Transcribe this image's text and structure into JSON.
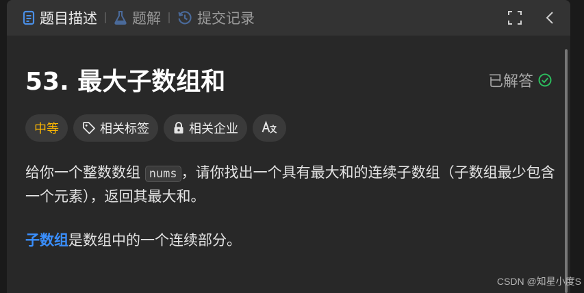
{
  "tabs": [
    {
      "label": "题目描述",
      "icon": "document-icon"
    },
    {
      "label": "题解",
      "icon": "flask-icon"
    },
    {
      "label": "提交记录",
      "icon": "history-icon"
    }
  ],
  "problem": {
    "title": "53. 最大子数组和",
    "status": "已解答"
  },
  "tags": {
    "difficulty": "中等",
    "related_tags": "相关标签",
    "related_companies": "相关企业",
    "translate_icon_text": "A文"
  },
  "description": {
    "part1": "给你一个整数数组 ",
    "code": "nums",
    "part2": "，请你找出一个具有最大和的连续子数组（子数组最少包含一个元素），返回其最大和。",
    "link": "子数组",
    "part3": "是数组中的一个连续部分。"
  },
  "watermark": "CSDN @知星小度S",
  "colors": {
    "difficulty_medium": "#ffb800",
    "solved_check": "#2cbb5d",
    "link": "#3a8fff",
    "tab_accent": "#4a8fe7"
  }
}
